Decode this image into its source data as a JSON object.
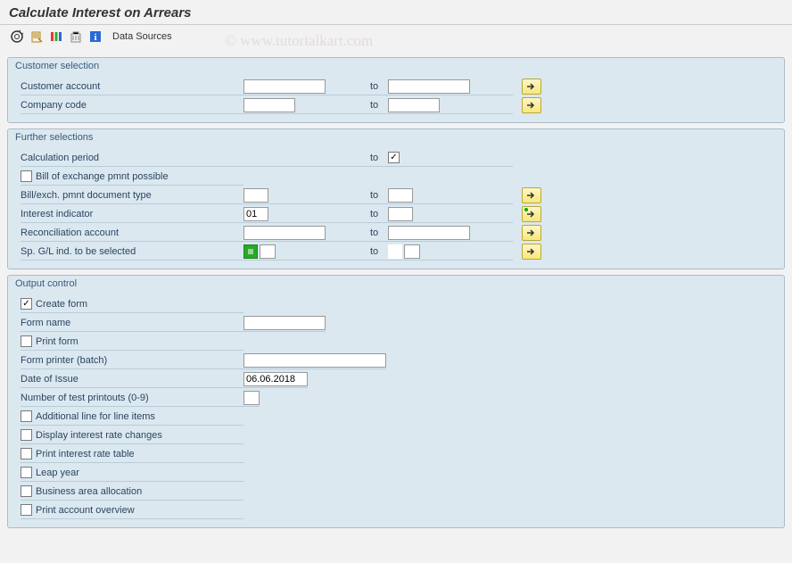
{
  "title": "Calculate Interest on Arrears",
  "watermark": "© www.tutorialkart.com",
  "toolbar": {
    "data_sources": "Data Sources"
  },
  "to_label": "to",
  "group1": {
    "header": "Customer selection",
    "customer_account_label": "Customer account",
    "customer_account_from": "",
    "customer_account_to": "",
    "company_code_label": "Company code",
    "company_code_from": "",
    "company_code_to": ""
  },
  "group2": {
    "header": "Further selections",
    "calc_period_label": "Calculation period",
    "calc_period_from": "",
    "calc_period_to": "",
    "bill_exch_possible_label": "Bill of exchange pmnt possible",
    "bill_exch_doc_type_label": "Bill/exch. pmnt document type",
    "bill_exch_doc_from": "",
    "bill_exch_doc_to": "",
    "interest_ind_label": "Interest indicator",
    "interest_ind_from": "01",
    "interest_ind_to": "",
    "recon_acct_label": "Reconciliation account",
    "recon_acct_from": "",
    "recon_acct_to": "",
    "sp_gl_label": "Sp. G/L ind. to be selected",
    "sp_gl_from": "",
    "sp_gl_to": ""
  },
  "group3": {
    "header": "Output control",
    "create_form_label": "Create form",
    "form_name_label": "Form name",
    "form_name_value": "",
    "print_form_label": "Print form",
    "form_printer_label": "Form printer (batch)",
    "form_printer_value": "",
    "date_issue_label": "Date of Issue",
    "date_issue_value": "06.06.2018",
    "num_test_label": "Number of test printouts (0-9)",
    "num_test_value": "",
    "addl_line_label": "Additional line for line items",
    "disp_rate_changes_label": "Display interest rate changes",
    "print_rate_table_label": "Print interest rate table",
    "leap_year_label": "Leap year",
    "business_area_label": "Business area allocation",
    "print_acct_overview_label": "Print account overview"
  }
}
